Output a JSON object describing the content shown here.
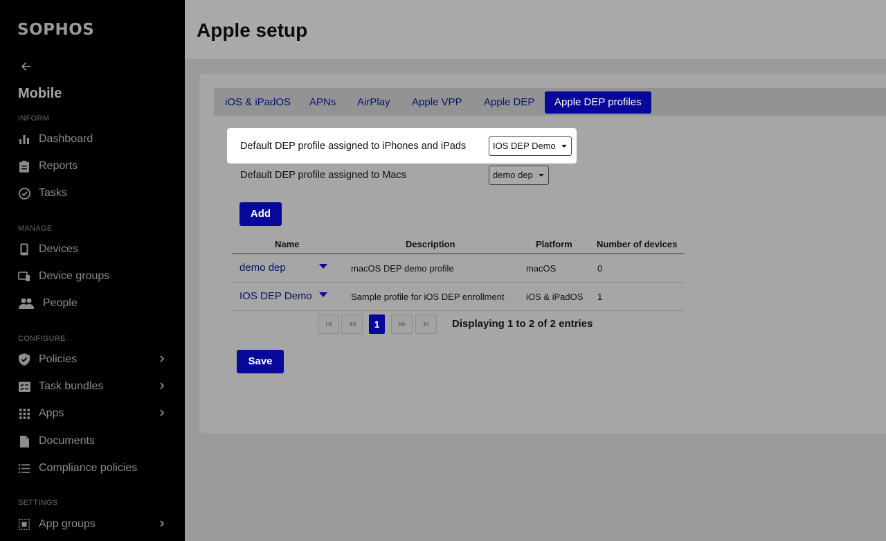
{
  "brand": {
    "logo": "SOPHOS",
    "accent": "#07079a"
  },
  "sidebar": {
    "app_title": "Mobile",
    "sections": {
      "inform": "INFORM",
      "manage": "MANAGE",
      "configure": "CONFIGURE",
      "settings": "SETTINGS"
    },
    "items": [
      {
        "label": "Dashboard",
        "icon": "bar-chart-icon"
      },
      {
        "label": "Reports",
        "icon": "clipboard-icon"
      },
      {
        "label": "Tasks",
        "icon": "check-circle-icon"
      },
      {
        "label": "Devices",
        "icon": "phone-icon"
      },
      {
        "label": "Device groups",
        "icon": "device-group-icon"
      },
      {
        "label": "People",
        "icon": "people-icon"
      },
      {
        "label": "Policies",
        "icon": "shield-icon"
      },
      {
        "label": "Task bundles",
        "icon": "task-bundle-icon"
      },
      {
        "label": "Apps",
        "icon": "grid-icon"
      },
      {
        "label": "Documents",
        "icon": "document-icon"
      },
      {
        "label": "Compliance policies",
        "icon": "list-icon"
      },
      {
        "label": "App groups",
        "icon": "app-group-icon"
      }
    ]
  },
  "header": {
    "title": "Apple setup"
  },
  "tabs": [
    {
      "label": "iOS & iPadOS"
    },
    {
      "label": "APNs"
    },
    {
      "label": "AirPlay"
    },
    {
      "label": "Apple VPP"
    },
    {
      "label": "Apple DEP"
    },
    {
      "label": "Apple DEP profiles",
      "active": true
    }
  ],
  "form": {
    "iphone_label": "Default DEP profile assigned to iPhones and iPads",
    "iphone_value": "IOS DEP Demo",
    "mac_label": "Default DEP profile assigned to Macs",
    "mac_value": "demo dep",
    "add_label": "Add",
    "save_label": "Save"
  },
  "table": {
    "columns": [
      "Name",
      "Description",
      "Platform",
      "Number of devices"
    ],
    "rows": [
      {
        "name": "demo dep",
        "description": "macOS DEP demo profile",
        "platform": "macOS",
        "devices": "0"
      },
      {
        "name": "IOS DEP Demo",
        "description": "Sample profile for iOS DEP enrollment",
        "platform": "iOS & iPadOS",
        "devices": "1"
      }
    ]
  },
  "pagination": {
    "current_page": "1",
    "info": "Displaying 1 to 2 of 2 entries"
  }
}
